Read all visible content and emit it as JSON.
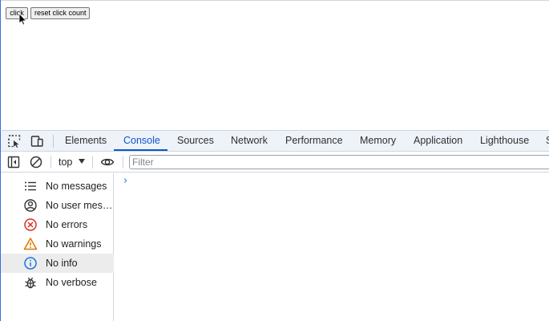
{
  "page": {
    "buttons": {
      "click_label": "click",
      "reset_label": "reset click count"
    }
  },
  "devtools": {
    "tabs": [
      {
        "label": "Elements",
        "active": false
      },
      {
        "label": "Console",
        "active": true
      },
      {
        "label": "Sources",
        "active": false
      },
      {
        "label": "Network",
        "active": false
      },
      {
        "label": "Performance",
        "active": false
      },
      {
        "label": "Memory",
        "active": false
      },
      {
        "label": "Application",
        "active": false
      },
      {
        "label": "Lighthouse",
        "active": false
      },
      {
        "label": "S",
        "active": false
      }
    ],
    "toolbar": {
      "context": "top",
      "filter_placeholder": "Filter"
    },
    "sidebar": [
      {
        "label": "No messages",
        "icon": "list-icon",
        "selected": false
      },
      {
        "label": "No user messages",
        "icon": "user-icon",
        "selected": false
      },
      {
        "label": "No errors",
        "icon": "error-icon",
        "selected": false
      },
      {
        "label": "No warnings",
        "icon": "warning-icon",
        "selected": false
      },
      {
        "label": "No info",
        "icon": "info-icon",
        "selected": true
      },
      {
        "label": "No verbose",
        "icon": "bug-icon",
        "selected": false
      }
    ],
    "prompt": "›"
  },
  "colors": {
    "accent": "#0b57d0",
    "error": "#d93025",
    "warning": "#e37400",
    "info": "#1a73e8"
  }
}
